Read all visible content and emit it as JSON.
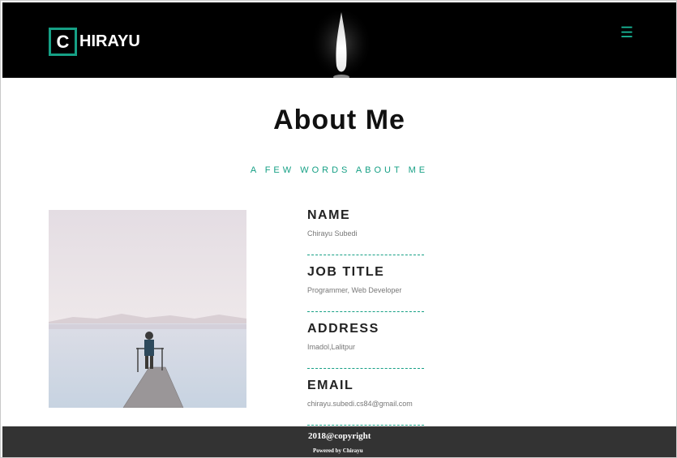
{
  "header": {
    "logo_letter": "C",
    "logo_rest": "HIRAYU",
    "menu_icon": "☰"
  },
  "about": {
    "title": "About Me",
    "subtitle": "A FEW WORDS ABOUT ME"
  },
  "info": [
    {
      "label": "NAME",
      "value": "Chirayu Subedi"
    },
    {
      "label": "JOB TITLE",
      "value": "Programmer, Web Developer"
    },
    {
      "label": "ADDRESS",
      "value": "Imadol,Lalitpur"
    },
    {
      "label": "EMAIL",
      "value": "chirayu.subedi.cs84@gmail.com"
    }
  ],
  "footer": {
    "copyright": "2018@copyright",
    "powered": "Powered by Chirayu"
  },
  "colors": {
    "accent": "#16a085",
    "header_bg": "#000000",
    "footer_bg": "#333333"
  },
  "icons": {
    "menu": "hamburger-menu-icon"
  }
}
